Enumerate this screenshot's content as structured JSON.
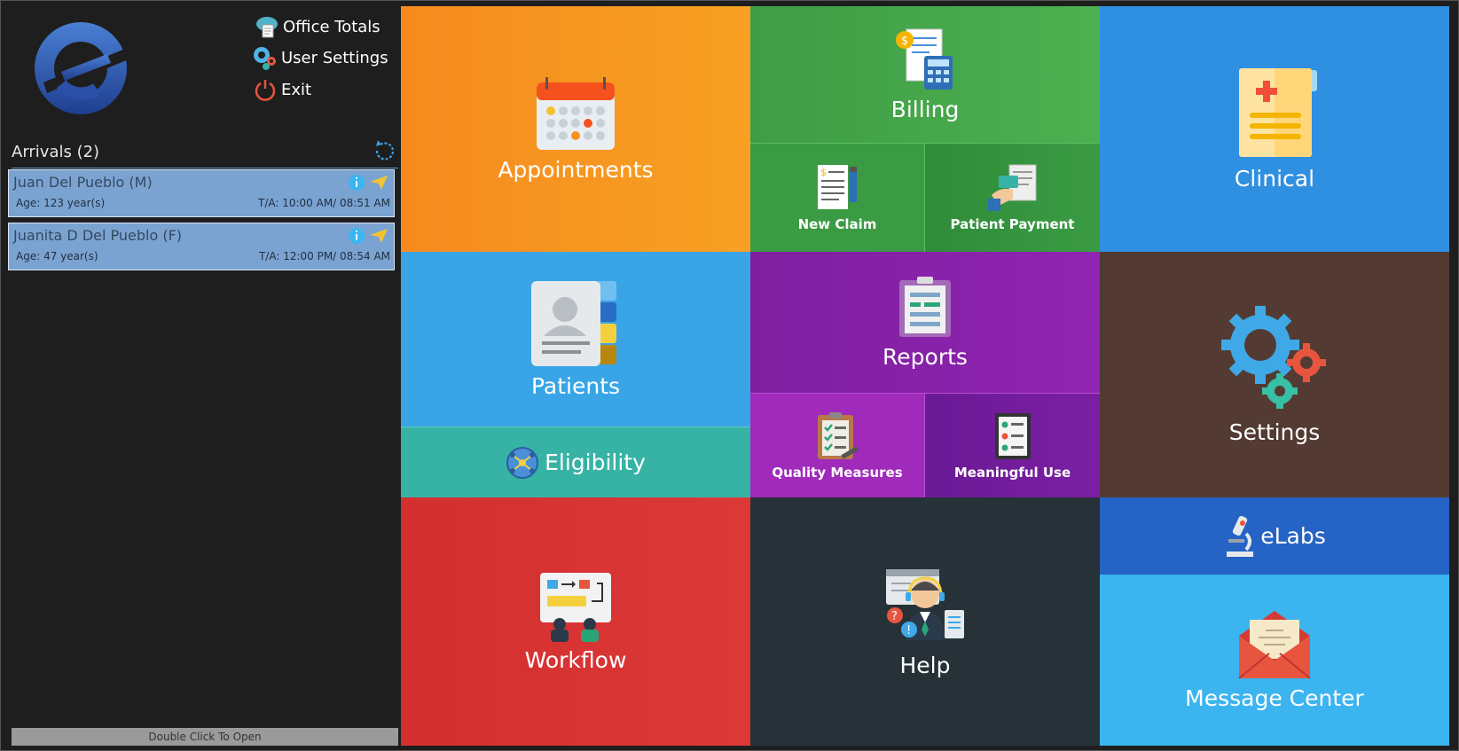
{
  "header": {
    "office_totals": "Office Totals",
    "user_settings": "User Settings",
    "exit": "Exit"
  },
  "arrivals": {
    "title": "Arrivals (2)",
    "patients": [
      {
        "name": "Juan Del Pueblo (M)",
        "age": "Age: 123 year(s)",
        "ta": "T/A: 10:00 AM/ 08:51 AM"
      },
      {
        "name": "Juanita D Del Pueblo (F)",
        "age": "Age: 47 year(s)",
        "ta": "T/A: 12:00 PM/ 08:54 AM"
      }
    ],
    "footer": "Double Click To Open"
  },
  "tiles": {
    "appointments": "Appointments",
    "billing": "Billing",
    "new_claim": "New Claim",
    "patient_payment": "Patient Payment",
    "clinical": "Clinical",
    "patients": "Patients",
    "eligibility": "Eligibility",
    "reports": "Reports",
    "quality_measures": "Quality Measures",
    "meaningful_use": "Meaningful Use",
    "settings": "Settings",
    "workflow": "Workflow",
    "help": "Help",
    "elabs": "eLabs",
    "message_center": "Message Center"
  },
  "colors": {
    "appointments": "#f7921e",
    "billing": "#4caf50",
    "billing_sub": "#3a9a44",
    "clinical": "#2f8fe0",
    "patients": "#39a5e6",
    "eligibility": "#37b3a6",
    "reports": "#8e24aa",
    "quality": "#a02aba",
    "meaningful": "#7b1fa2",
    "settings": "#533b33",
    "workflow": "#d93333",
    "help": "#263238",
    "elabs": "#2563c4",
    "message_center": "#3bb4ef"
  }
}
